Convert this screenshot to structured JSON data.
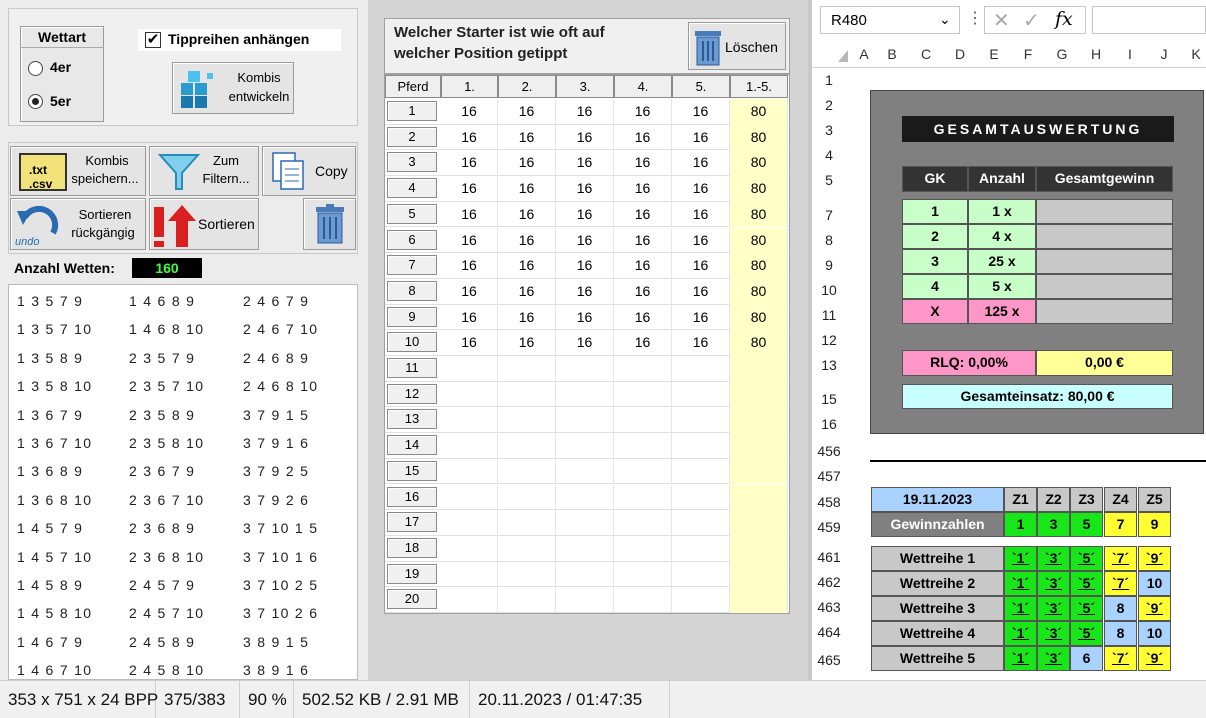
{
  "left": {
    "wettart_label": "Wettart",
    "opt4": "4er",
    "opt5": "5er",
    "tipp_label": "Tippreihen anhängen",
    "tipp_checked": "✔",
    "kombis_entwickeln": [
      "Kombis",
      "entwickeln"
    ],
    "save": [
      "Kombis",
      "speichern..."
    ],
    "save_icon_text": [
      ".txt",
      ".csv"
    ],
    "filter": [
      "Zum",
      "Filtern..."
    ],
    "copy": "Copy",
    "undo": [
      "Sortieren",
      "rückgängig"
    ],
    "undo_icon_text": "undo",
    "sort": "Sortieren",
    "count_label": "Anzahl Wetten:",
    "count_value": "160",
    "combos": [
      [
        "1 3 5 7 9",
        "1 4 6 8 9",
        "2 4 6 7 9"
      ],
      [
        "1 3 5 7 10",
        "1 4 6 8 10",
        "2 4 6 7 10"
      ],
      [
        "1 3 5 8 9",
        "2 3 5 7 9",
        "2 4 6 8 9"
      ],
      [
        "1 3 5 8 10",
        "2 3 5 7 10",
        "2 4 6 8 10"
      ],
      [
        "1 3 6 7 9",
        "2 3 5 8 9",
        "3 7 9 1 5"
      ],
      [
        "1 3 6 7 10",
        "2 3 5 8 10",
        "3 7 9 1 6"
      ],
      [
        "1 3 6 8 9",
        "2 3 6 7 9",
        "3 7 9 2 5"
      ],
      [
        "1 3 6 8 10",
        "2 3 6 7 10",
        "3 7 9 2 6"
      ],
      [
        "1 4 5 7 9",
        "2 3 6 8 9",
        "3 7 10 1 5"
      ],
      [
        "1 4 5 7 10",
        "2 3 6 8 10",
        "3 7 10 1 6"
      ],
      [
        "1 4 5 8 9",
        "2 4 5 7 9",
        "3 7 10 2 5"
      ],
      [
        "1 4 5 8 10",
        "2 4 5 7 10",
        "3 7 10 2 6"
      ],
      [
        "1 4 6 7 9",
        "2 4 5 8 9",
        "3 8 9 1 5"
      ],
      [
        "1 4 6 7 10",
        "2 4 5 8 10",
        "3 8 9 1 6"
      ]
    ]
  },
  "middle": {
    "title_line1": "Welcher Starter ist wie oft auf",
    "title_line2": "welcher Position getippt",
    "delete": "Löschen",
    "headers": [
      "Pferd",
      "1.",
      "2.",
      "3.",
      "4.",
      "5.",
      "1.-5."
    ],
    "rows": [
      [
        "1",
        "16",
        "16",
        "16",
        "16",
        "16",
        "80"
      ],
      [
        "2",
        "16",
        "16",
        "16",
        "16",
        "16",
        "80"
      ],
      [
        "3",
        "16",
        "16",
        "16",
        "16",
        "16",
        "80"
      ],
      [
        "4",
        "16",
        "16",
        "16",
        "16",
        "16",
        "80"
      ],
      [
        "5",
        "16",
        "16",
        "16",
        "16",
        "16",
        "80"
      ],
      [
        "6",
        "16",
        "16",
        "16",
        "16",
        "16",
        "80"
      ],
      [
        "7",
        "16",
        "16",
        "16",
        "16",
        "16",
        "80"
      ],
      [
        "8",
        "16",
        "16",
        "16",
        "16",
        "16",
        "80"
      ],
      [
        "9",
        "16",
        "16",
        "16",
        "16",
        "16",
        "80"
      ],
      [
        "10",
        "16",
        "16",
        "16",
        "16",
        "16",
        "80"
      ],
      [
        "11",
        "",
        "",
        "",
        "",
        "",
        ""
      ],
      [
        "12",
        "",
        "",
        "",
        "",
        "",
        ""
      ],
      [
        "13",
        "",
        "",
        "",
        "",
        "",
        ""
      ],
      [
        "14",
        "",
        "",
        "",
        "",
        "",
        ""
      ],
      [
        "15",
        "",
        "",
        "",
        "",
        "",
        ""
      ],
      [
        "16",
        "",
        "",
        "",
        "",
        "",
        ""
      ],
      [
        "17",
        "",
        "",
        "",
        "",
        "",
        ""
      ],
      [
        "18",
        "",
        "",
        "",
        "",
        "",
        ""
      ],
      [
        "19",
        "",
        "",
        "",
        "",
        "",
        ""
      ],
      [
        "20",
        "",
        "",
        "",
        "",
        "",
        ""
      ]
    ]
  },
  "excel": {
    "namebox": "R480",
    "fx": "fx",
    "cols": [
      "A",
      "B",
      "C",
      "D",
      "E",
      "F",
      "G",
      "H",
      "I",
      "J",
      "K"
    ],
    "rownums": [
      "1",
      "2",
      "3",
      "4",
      "5",
      "7",
      "8",
      "9",
      "10",
      "11",
      "12",
      "13",
      "15",
      "16",
      "456",
      "457",
      "458",
      "459",
      "461",
      "462",
      "463",
      "464",
      "465"
    ],
    "title": "GESAMTAUSWERTUNG",
    "gk_headers": [
      "GK",
      "Anzahl",
      "Gesamtgewinn"
    ],
    "gk_rows": [
      [
        "1",
        "1 x",
        ""
      ],
      [
        "2",
        "4 x",
        ""
      ],
      [
        "3",
        "25 x",
        ""
      ],
      [
        "4",
        "5 x",
        ""
      ],
      [
        "X",
        "125 x",
        ""
      ]
    ],
    "rlq": "RLQ: 0,00%",
    "rlq_value": "0,00 €",
    "einsatz": "Gesamteinsatz: 80,00 €",
    "date": "19.11.2023",
    "z_headers": [
      "Z1",
      "Z2",
      "Z3",
      "Z4",
      "Z5"
    ],
    "gewinn_label": "Gewinnzahlen",
    "gewinn": [
      "1",
      "3",
      "5",
      "7",
      "9"
    ],
    "wettreihen": [
      {
        "label": "Wettreihe 1",
        "vals": [
          "`1´",
          "`3´",
          "`5´",
          "`7´",
          "`9´"
        ],
        "cls": [
          "g",
          "g",
          "g",
          "y",
          "y"
        ]
      },
      {
        "label": "Wettreihe 2",
        "vals": [
          "`1´",
          "`3´",
          "`5´",
          "`7´",
          "10"
        ],
        "cls": [
          "g",
          "g",
          "g",
          "y",
          "b"
        ]
      },
      {
        "label": "Wettreihe 3",
        "vals": [
          "`1´",
          "`3´",
          "`5´",
          "8",
          "`9´"
        ],
        "cls": [
          "g",
          "g",
          "g",
          "b",
          "y"
        ]
      },
      {
        "label": "Wettreihe 4",
        "vals": [
          "`1´",
          "`3´",
          "`5´",
          "8",
          "10"
        ],
        "cls": [
          "g",
          "g",
          "g",
          "b",
          "b"
        ]
      },
      {
        "label": "Wettreihe 5",
        "vals": [
          "`1´",
          "`3´",
          "6",
          "`7´",
          "`9´"
        ],
        "cls": [
          "g",
          "g",
          "b",
          "y",
          "y"
        ]
      }
    ],
    "colors": {
      "gk_green": "#c8ffc8",
      "gk_pink": "#ff96c8",
      "yellow": "#ffff96",
      "cyan": "#c8ffff",
      "panel": "#808080"
    }
  },
  "status": [
    "353 x 751 x 24 BPP",
    "375/383",
    "90 %",
    "502.52 KB / 2.91 MB",
    "20.11.2023 / 01:47:35"
  ]
}
